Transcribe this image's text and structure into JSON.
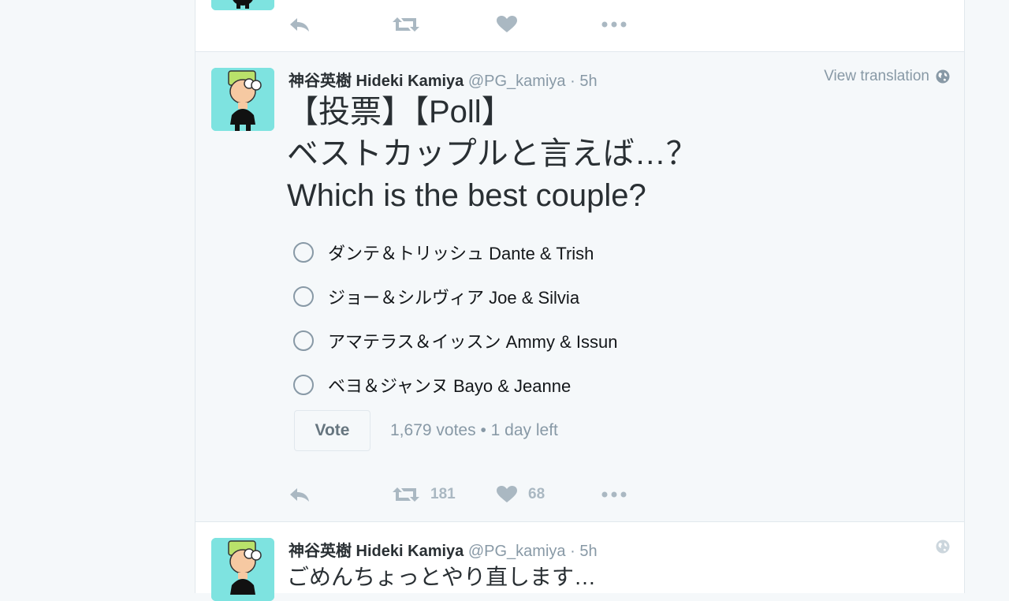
{
  "colors": {
    "muted": "#8899a6",
    "action_icon": "#aab8c2",
    "avatar_bg": "#7ee3e0",
    "text": "#292f33"
  },
  "previous_tweet": {
    "actions": {
      "reply_icon": "reply-icon",
      "retweet_icon": "retweet-icon",
      "like_icon": "heart-icon",
      "more_icon": "more-icon"
    }
  },
  "poll_tweet": {
    "fullname": "神谷英樹 Hideki Kamiya",
    "username": "@PG_kamiya",
    "separator": "·",
    "time": "5h",
    "translate_label": "View translation",
    "text_lines": [
      "【投票】【Poll】",
      "ベストカップルと言えば…？",
      "Which is the best couple?"
    ],
    "choices": [
      "ダンテ＆トリッシュ Dante & Trish",
      "ジョー＆シルヴィア Joe & Silvia",
      "アマテラス＆イッスン Ammy & Issun",
      "ベヨ＆ジャンヌ Bayo & Jeanne"
    ],
    "vote_label": "Vote",
    "votes_text": "1,679 votes",
    "bullet": "•",
    "time_left": "1 day left",
    "retweet_count": "181",
    "like_count": "68"
  },
  "next_tweet": {
    "fullname": "神谷英樹 Hideki Kamiya",
    "username": "@PG_kamiya",
    "separator": "·",
    "time": "5h",
    "text": "ごめんちょっとやり直します…"
  }
}
